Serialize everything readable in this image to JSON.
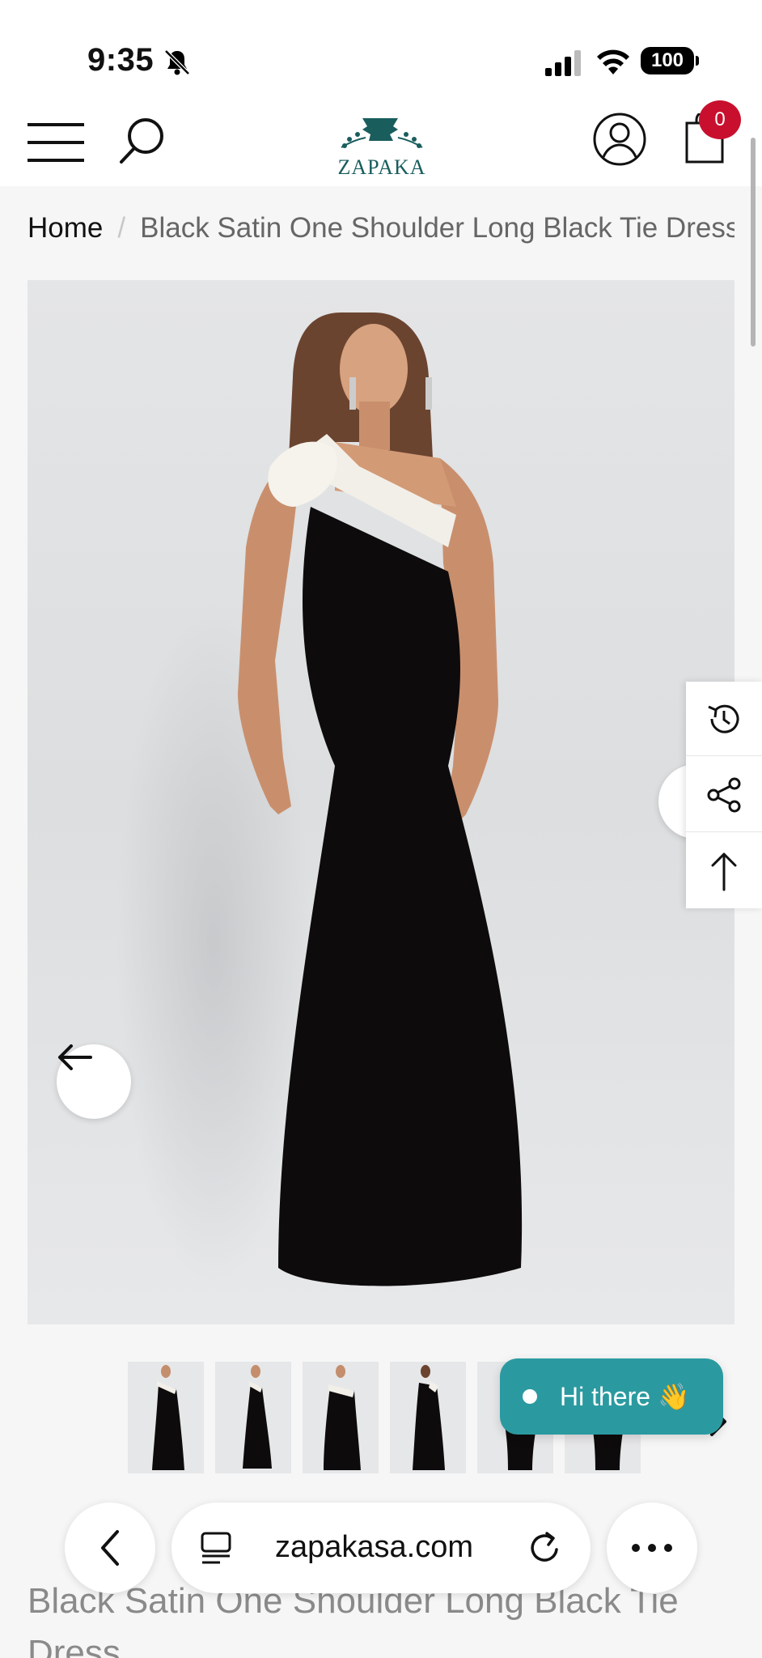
{
  "status_bar": {
    "time": "9:35",
    "battery": "100"
  },
  "header": {
    "logo_text": "ZAPAKA",
    "cart_count": "0"
  },
  "breadcrumb": {
    "home": "Home",
    "separator": "/",
    "current": "Black Satin One Shoulder Long Black Tie Dress"
  },
  "chat": {
    "label": "Hi there 👋"
  },
  "browser": {
    "url": "zapakasa.com"
  },
  "product": {
    "title": "Black Satin One Shoulder Long Black Tie Dress"
  },
  "colors": {
    "brand_teal": "#1a5d5d",
    "chat_teal": "#2a9aa0",
    "cart_badge": "#c8102e"
  },
  "icons": [
    "bell-slash-icon",
    "signal-icon",
    "wifi-icon",
    "menu-icon",
    "search-icon",
    "account-icon",
    "cart-icon",
    "arrow-left-icon",
    "history-icon",
    "share-icon",
    "arrow-up-icon",
    "chevron-right-icon",
    "chevron-left-icon",
    "tabs-icon",
    "reload-icon",
    "more-icon"
  ]
}
